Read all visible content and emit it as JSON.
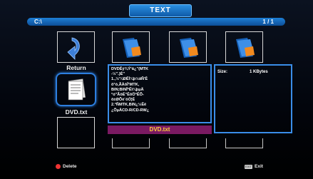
{
  "header": {
    "title": "TEXT"
  },
  "path_bar": {
    "path": "C:\\",
    "page": "1 / 1"
  },
  "grid": {
    "return_label": "Return",
    "selected_file_label": "DVD.txt"
  },
  "preview": {
    "lines": [
      "DVDÊý¾Ý¹â¿\"(MTK",
      "-½\".)É\"",
      "1.,½'¼ÐÊÌ¼þ½âÑ'Ê",
      "õ°ó,ÃÀôÎ¹MTK,",
      "BIN;BINÎ*Êï¼þµÄ",
      "°ó\"ÃöÉ\"ÊôÖ°ÊÕ-",
      "õ±ØÕè¨öÓ¦É",
      "2.°ÑMTK,BIN¿½Êê",
      "¿ÕµÄCD-R/CD-RW¿"
    ]
  },
  "info": {
    "size_label": "Size:",
    "size_value": "1 KBytes"
  },
  "name_bar": {
    "filename": "DVD.txt"
  },
  "footer": {
    "delete_label": "Delete",
    "exit_label": "Exit",
    "exit_key": "EXIT"
  },
  "colors": {
    "accent": "#2d7fe0",
    "namebar_bg": "#7a1a62",
    "namebar_text": "#ffd23a",
    "delete_dot": "#e33333"
  }
}
